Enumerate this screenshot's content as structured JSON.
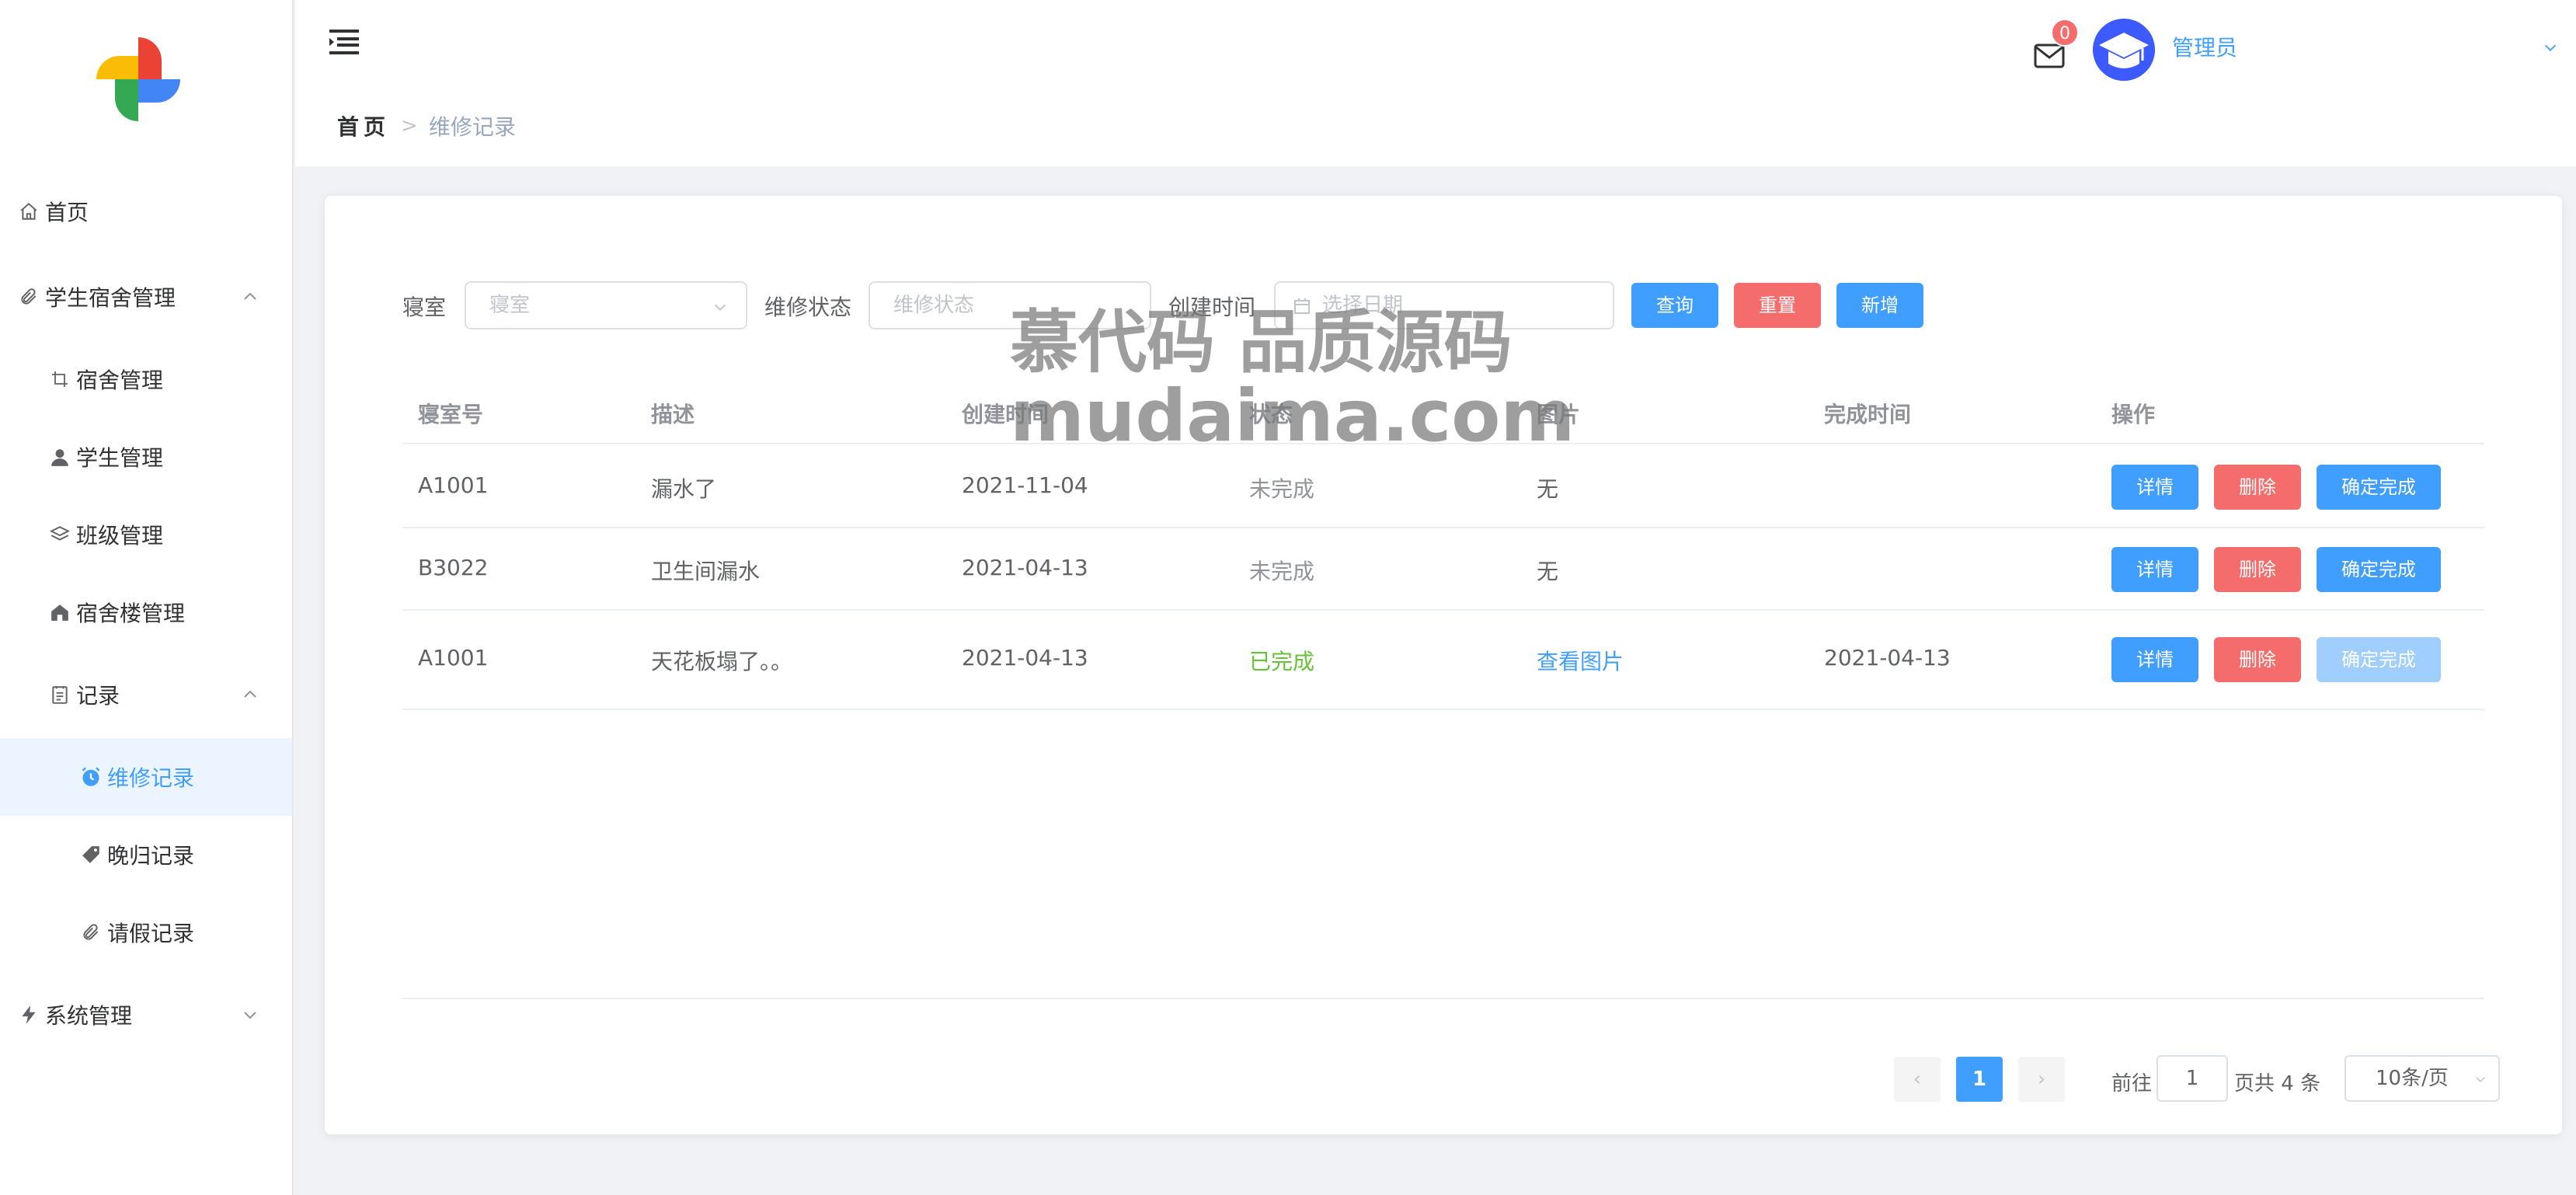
{
  "sidebar": {
    "items": [
      {
        "label": "首页",
        "icon": "home-icon"
      },
      {
        "label": "学生宿舍管理",
        "icon": "paperclip-icon"
      },
      {
        "label": "宿舍管理",
        "icon": "crop-icon"
      },
      {
        "label": "学生管理",
        "icon": "user-icon"
      },
      {
        "label": "班级管理",
        "icon": "layers-icon"
      },
      {
        "label": "宿舍楼管理",
        "icon": "house-icon"
      },
      {
        "label": "记录",
        "icon": "notebook-icon"
      },
      {
        "label": "维修记录",
        "icon": "alarm-clock-icon"
      },
      {
        "label": "晚归记录",
        "icon": "tag-icon"
      },
      {
        "label": "请假记录",
        "icon": "paperclip-icon"
      },
      {
        "label": "系统管理",
        "icon": "lightning-icon"
      }
    ]
  },
  "header": {
    "breadcrumb_home": "首页",
    "breadcrumb_sep": ">",
    "breadcrumb_current": "维修记录",
    "mail_badge": "0",
    "user_name": "管理员"
  },
  "filters": {
    "dorm_label": "寝室",
    "dorm_placeholder": "寝室",
    "status_label": "维修状态",
    "status_placeholder": "维修状态",
    "created_label": "创建时间",
    "date_placeholder": "选择日期",
    "search_btn": "查询",
    "reset_btn": "重置",
    "add_btn": "新增"
  },
  "table": {
    "headers": [
      "寝室号",
      "描述",
      "创建时间",
      "状态",
      "图片",
      "完成时间",
      "操作"
    ],
    "rows": [
      {
        "dorm": "A1001",
        "desc": "漏水了",
        "created": "2021-11-04",
        "status": "未完成",
        "image": "无",
        "finished": ""
      },
      {
        "dorm": "B3022",
        "desc": "卫生间漏水",
        "created": "2021-04-13",
        "status": "未完成",
        "image": "无",
        "finished": ""
      },
      {
        "dorm": "A1001",
        "desc": "天花板塌了。。",
        "created": "2021-04-13",
        "status": "已完成",
        "image": "查看图片",
        "finished": "2021-04-13"
      }
    ],
    "detail_btn": "详情",
    "delete_btn": "删除",
    "confirm_btn": "确定完成"
  },
  "pagination": {
    "current_page": "1",
    "goto_label": "前往",
    "goto_value": "1",
    "total_text": "页共 4 条",
    "page_size": "10条/页",
    "prev": "‹",
    "next": "›"
  },
  "watermark": {
    "line1": "慕代码 品质源码",
    "line2": "mudaima.com"
  },
  "colors": {
    "primary": "#409eff",
    "danger": "#f56c6c",
    "success": "#67c23a",
    "disabled": "#a0cfff"
  }
}
